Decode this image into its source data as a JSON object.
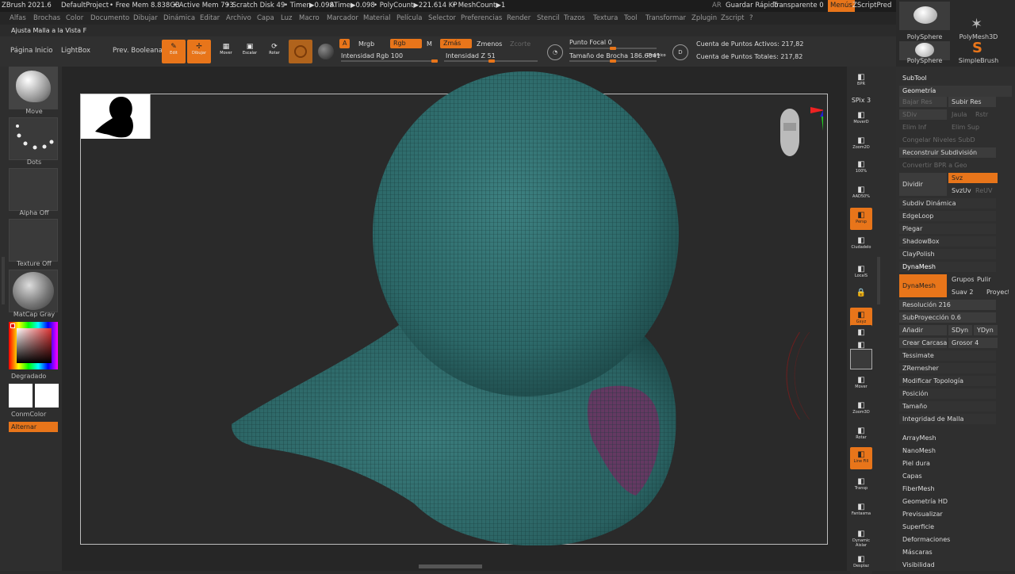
{
  "titlebar": {
    "items": [
      "ZBrush 2021.6",
      "DefaultProject",
      "• Free Mem 8.838GB",
      "• Active Mem 793",
      "• Scratch Disk 49",
      "• Timer▶0.098",
      "ATime▶0.098",
      "• PolyCount▶221.614 KP",
      "• MeshCount▶1"
    ],
    "ar": "AR",
    "quick_save": "Guardar Rápido",
    "transparent": "Transparente 0",
    "menus": "Menús",
    "default_script": "ZScriptPred"
  },
  "menubar": [
    "Alfas",
    "Brochas",
    "Color",
    "Documento",
    "Dibujar",
    "Dinámica",
    "Editar",
    "Archivo",
    "Capa",
    "Luz",
    "Macro",
    "Marcador",
    "Material",
    "Película",
    "Selector",
    "Preferencias",
    "Render",
    "Stencil",
    "Trazos",
    "Textura",
    "Tool",
    "Transformar",
    "Zplugin",
    "Zscript",
    "?"
  ],
  "hint": "Ajusta Malla a la Vista F",
  "toptray": {
    "home_page": "Página Inicio",
    "lightbox": "LightBox",
    "boolean_preview": "Prev. Booleana",
    "edit": "Edit",
    "draw": "Dibujar",
    "move": "Mover",
    "scale": "Escalar",
    "rotate": "Rotar",
    "a_chip": "A",
    "mrgb": "Mrgb",
    "rgb": "Rgb",
    "m": "M",
    "zadd": "Zmás",
    "zsub": "Zmenos",
    "zcut": "Zcorte",
    "rgb_intensity": "Intensidad Rgb 100",
    "z_intensity": "Intensidad Z 51",
    "focal_shift": "Punto Focal 0",
    "brush_size": "Tamaño de Brocha 186.6041",
    "dynamic": "Dinámico",
    "active_points": "Cuenta de Puntos Activos: 217,82",
    "total_points": "Cuenta de Puntos Totales: 217,82",
    "rgb_intensity_level": 1.0,
    "z_intensity_level": 0.51,
    "brush_size_level": 0.5
  },
  "lefttray": {
    "brush": "Move",
    "stroke": "Dots",
    "alpha": "Alpha Off",
    "texture": "Texture Off",
    "material": "MatCap Gray",
    "gradient": "Degradado",
    "switch_color": "ConmColor",
    "alternate": "Alternar"
  },
  "righttray": [
    "BPR",
    "SPix 3",
    "MoverD",
    "Zoom2D",
    "100%",
    "AAD50%",
    "Persp",
    "Ciudadelo",
    "LocalS",
    "",
    "Gxyz",
    "",
    "",
    "Mover",
    "Zoom3D",
    "Rotar",
    "Line Fill",
    "Transp",
    "Fantasma",
    "Dynamic Aislar",
    "Desplaz"
  ],
  "subtools": {
    "thumbs": [
      "PolySphere",
      "PolyMesh3D",
      "PolySphere",
      "SimpleBrush"
    ]
  },
  "palette": {
    "subtool": "SubTool",
    "geometry": "Geometría",
    "lower_res": "Bajar Res",
    "higher_res": "Subir Res",
    "sdiv": "SDiv",
    "cage": "Jaula",
    "rstr": "Rstr",
    "del_lower": "Elim Inf",
    "del_higher": "Elim Sup",
    "freeze_subdiv": "Congelar Niveles SubD",
    "reconstruct": "Reconstruir Subdivisión",
    "convert_bpr": "Convertir BPR a Geo",
    "divide": "Dividir",
    "smt": "Svz",
    "suv": "SvzUv",
    "reuv": "ReUV",
    "dynamic_subdiv": "Subdiv Dinámica",
    "edgeloop": "EdgeLoop",
    "crease": "Plegar",
    "shadowbox": "ShadowBox",
    "claypolish": "ClayPolish",
    "dynamesh_header": "DynaMesh",
    "dynamesh_btn": "DynaMesh",
    "groups": "Grupos",
    "polish": "Pulir",
    "blur": "Suav 2",
    "project": "Proyect",
    "resolution": "Resolución 216",
    "subprojection": "SubProyección 0.6",
    "add": "Añadir",
    "sdyn": "SDyn",
    "ydyn": "YDyn",
    "create_shell": "Crear Carcasa",
    "thickness": "Grosor 4",
    "tessimate": "Tessimate",
    "zremesher": "ZRemesher",
    "modify_topology": "Modificar Topología",
    "position": "Posición",
    "size": "Tamaño",
    "mesh_integrity": "Integridad de Malla",
    "arraymesh": "ArrayMesh",
    "nanomesh": "NanoMesh",
    "thick_skin": "Piel dura",
    "layers": "Capas",
    "fibermesh": "FiberMesh",
    "hd_geometry": "Geometría HD",
    "preview": "Previsualizar",
    "surface": "Superficie",
    "deformation": "Deformaciones",
    "masking": "Máscaras",
    "visibility": "Visibilidad"
  },
  "colors": {
    "accent": "#e8751a",
    "mesh": "#2f6e6e",
    "mask": "#7a3a6e"
  }
}
